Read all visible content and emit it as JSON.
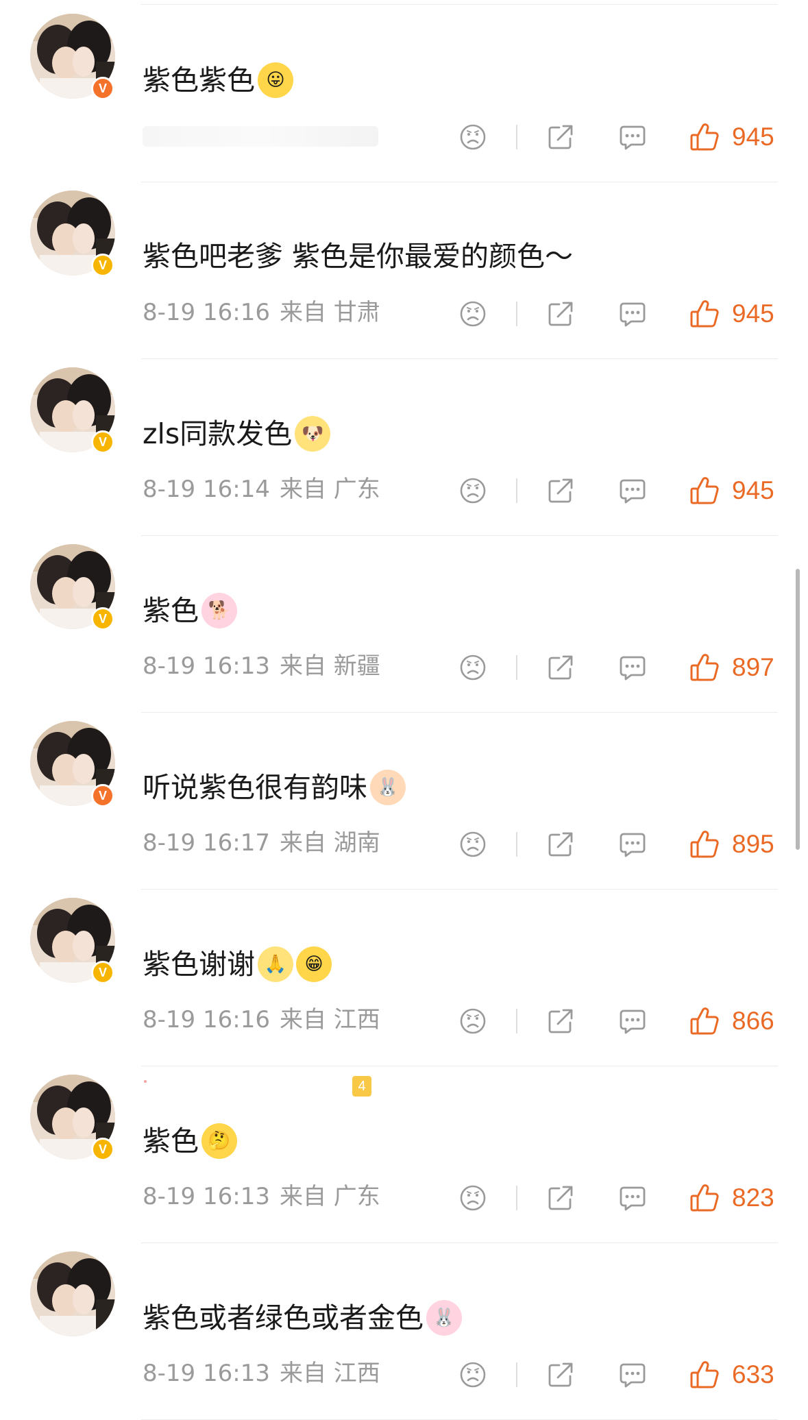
{
  "colors": {
    "like": "#ea6a25",
    "meta": "#9a9a9a",
    "text": "#1a1a1a",
    "badge_orange": "#f5722b",
    "badge_gold": "#f7b500"
  },
  "icons": {
    "dislike": "sad-face-icon",
    "share": "share-icon",
    "reply": "comment-icon",
    "like": "thumbs-up-icon"
  },
  "comments": [
    {
      "text": "紫色紫色",
      "emojis": [
        "😛"
      ],
      "time": "",
      "ip": "",
      "likes": "945",
      "badge": "V",
      "badge_color": "orange",
      "level": ""
    },
    {
      "text": "紫色吧老爹 紫色是你最爱的颜色～",
      "emojis": [],
      "time": "8-19 16:16",
      "ip": "来自 甘肃",
      "likes": "945",
      "badge": "V",
      "badge_color": "gold",
      "level": ""
    },
    {
      "text": "zls同款发色",
      "emojis": [
        "🐶"
      ],
      "time": "8-19 16:14",
      "ip": "来自 广东",
      "likes": "945",
      "badge": "V",
      "badge_color": "gold",
      "level": ""
    },
    {
      "text": "紫色",
      "emojis": [
        "🐕"
      ],
      "time": "8-19 16:13",
      "ip": "来自 新疆",
      "likes": "897",
      "badge": "V",
      "badge_color": "gold",
      "level": ""
    },
    {
      "text": "听说紫色很有韵味",
      "emojis": [
        "🐰"
      ],
      "time": "8-19 16:17",
      "ip": "来自 湖南",
      "likes": "895",
      "badge": "V",
      "badge_color": "orange",
      "level": ""
    },
    {
      "text": "紫色谢谢",
      "emojis": [
        "🙏",
        "😁"
      ],
      "time": "8-19 16:16",
      "ip": "来自 江西",
      "likes": "866",
      "badge": "V",
      "badge_color": "gold",
      "level": ""
    },
    {
      "text": "紫色",
      "emojis": [
        "🤔"
      ],
      "time": "8-19 16:13",
      "ip": "来自 广东",
      "likes": "823",
      "badge": "V",
      "badge_color": "gold",
      "level": "4"
    },
    {
      "text": "紫色或者绿色或者金色",
      "emojis": [
        "🐰"
      ],
      "time": "8-19 16:13",
      "ip": "来自 江西",
      "likes": "633",
      "badge": "",
      "badge_color": "",
      "level": ""
    }
  ]
}
